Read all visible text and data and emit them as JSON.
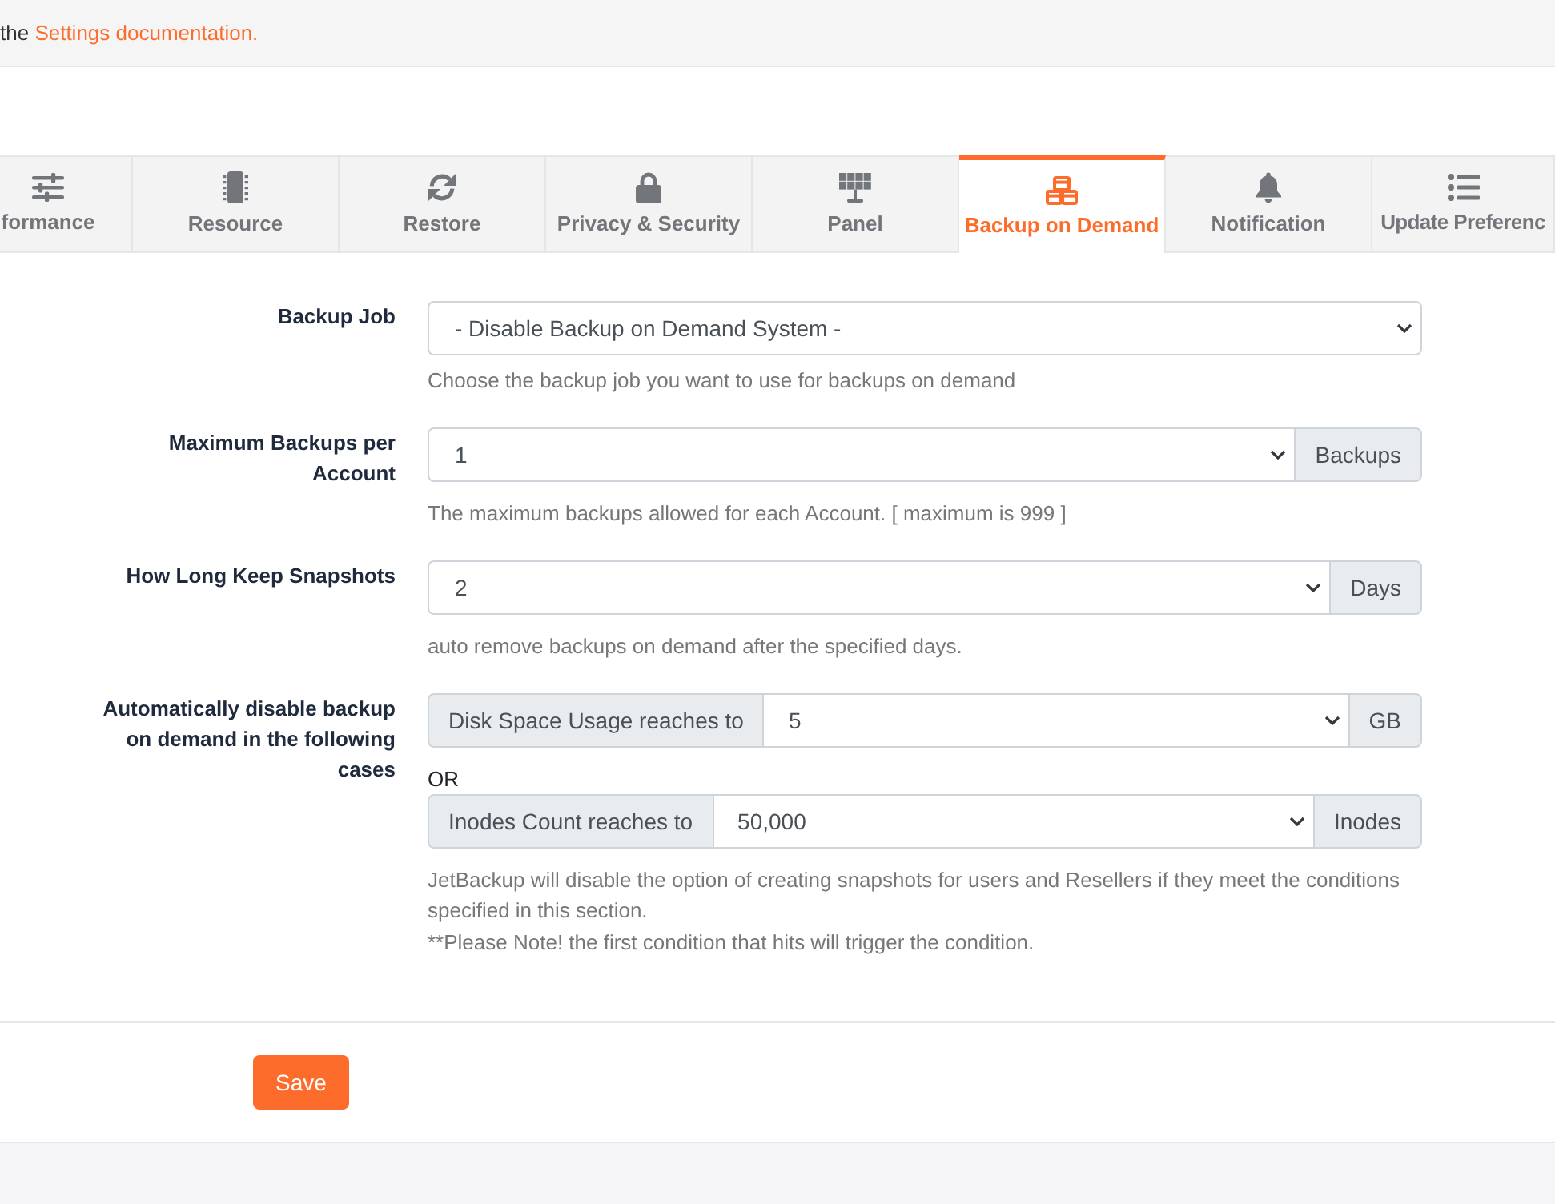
{
  "notice": {
    "text": "the",
    "link": "Settings documentation."
  },
  "tabs": [
    {
      "label": "formance",
      "selected": false
    },
    {
      "label": "Resource",
      "selected": false
    },
    {
      "label": "Restore",
      "selected": false
    },
    {
      "label": "Privacy & Security",
      "selected": false
    },
    {
      "label": "Panel",
      "selected": false
    },
    {
      "label": "Backup on Demand",
      "selected": true
    },
    {
      "label": "Notification",
      "selected": false
    },
    {
      "label": "Update Preferenc",
      "selected": false
    }
  ],
  "form": {
    "fields": [
      {
        "kind": "select",
        "label": "Backup Job",
        "value": "- Disable Backup on Demand System -",
        "help": [
          "Choose the backup job you want to use for backups on demand"
        ]
      },
      {
        "kind": "select_addon",
        "label": "Maximum Backups per Account",
        "value": "1",
        "suffix": "Backups",
        "help": [
          "The maximum backups allowed for each Account. [ maximum is 999 ]"
        ]
      },
      {
        "kind": "select_addon",
        "label": "How Long Keep Snapshots",
        "value": "2",
        "suffix": "Days",
        "help": [
          "auto remove backups on demand after the specified days."
        ]
      },
      {
        "kind": "conditions",
        "label": "Automatically disable backup on demand in the following cases",
        "conditions": [
          {
            "prefix": "Disk Space Usage reaches to",
            "value": "5",
            "suffix": "GB"
          },
          {
            "prefix": "Inodes Count reaches to",
            "value": "50,000",
            "suffix": "Inodes"
          }
        ],
        "separator": "OR",
        "help": [
          "JetBackup will disable the option of creating snapshots for users and Resellers if they meet the conditions specified in this section.",
          "**Please Note! the first condition that hits will trigger the condition."
        ]
      }
    ]
  },
  "save_button": {
    "label": "Save"
  }
}
